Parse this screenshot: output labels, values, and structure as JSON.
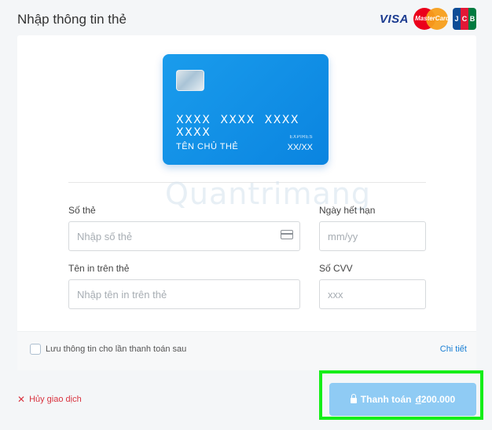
{
  "header": {
    "title": "Nhập thông tin thẻ",
    "brands": {
      "visa": "VISA",
      "mastercard": "MasterCard",
      "jcb": [
        "J",
        "C",
        "B"
      ]
    }
  },
  "card_preview": {
    "number": "XXXX XXXX XXXX XXXX",
    "holder": "TÊN CHỦ THẺ",
    "expires_label": "EXPIRES",
    "expires_value": "XX/XX",
    "color": "#0a8ee8"
  },
  "watermark": "Quantrimang",
  "form": {
    "card_number": {
      "label": "Số thẻ",
      "placeholder": "Nhập số thẻ",
      "value": ""
    },
    "expiry": {
      "label": "Ngày hết hạn",
      "placeholder": "mm/yy",
      "value": ""
    },
    "name_on_card": {
      "label": "Tên in trên thẻ",
      "placeholder": "Nhập tên in trên thẻ",
      "value": ""
    },
    "cvv": {
      "label": "Số CVV",
      "placeholder": "xxx",
      "value": ""
    }
  },
  "save_info": {
    "label": "Lưu thông tin cho lần thanh toán sau",
    "checked": false
  },
  "details_link": "Chi tiết",
  "cancel": {
    "icon": "close-icon",
    "label": "Hủy giao dịch"
  },
  "pay_button": {
    "label": "Thanh toán",
    "currency": "đ",
    "amount": "200.000",
    "icon": "lock-icon",
    "highlight_color": "#15ee18"
  }
}
